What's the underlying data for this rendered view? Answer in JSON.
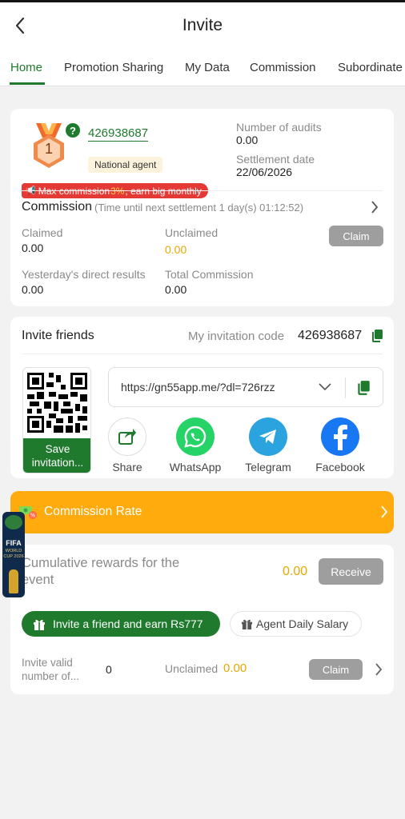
{
  "header": {
    "title": "Invite"
  },
  "tabs": [
    "Home",
    "Promotion Sharing",
    "My Data",
    "Commission",
    "Subordinate"
  ],
  "agent": {
    "level": "1",
    "id": "426938687",
    "badge": "National agent",
    "audits_label": "Number of audits",
    "audits_value": "0.00",
    "settlement_label": "Settlement date",
    "settlement_value": "22/06/2026"
  },
  "promo_banner": {
    "text_before": "Max commission ",
    "highlight": "3%",
    "text_after": ", earn big monthly"
  },
  "commission": {
    "title": "Commission",
    "countdown": "(Time until next settlement  1 day(s) 01:12:52)",
    "claimed_label": "Claimed",
    "claimed_value": "0.00",
    "unclaimed_label": "Unclaimed",
    "unclaimed_value": "0.00",
    "claim_button": "Claim",
    "yesterday_label": "Yesterday's direct results",
    "yesterday_value": "0.00",
    "total_label": "Total Commission",
    "total_value": "0.00"
  },
  "invite": {
    "title": "Invite friends",
    "code_label": "My invitation code",
    "code_value": "426938687",
    "link": "https://gn55app.me/?dl=726rzz",
    "save_label": "Save invitation...",
    "share": [
      {
        "label": "Share",
        "icon": "share-icon",
        "color": "#1f7a2e"
      },
      {
        "label": "WhatsApp",
        "icon": "whatsapp-icon",
        "color": "#25d366"
      },
      {
        "label": "Telegram",
        "icon": "telegram-icon",
        "color": "#2aa3df"
      },
      {
        "label": "Facebook",
        "icon": "facebook-icon",
        "color": "#1877f2"
      }
    ]
  },
  "commission_rate": {
    "label": "Commission Rate"
  },
  "floating_badge": {
    "text_top": "FIFA",
    "text_bottom": "WORLD CUP 2026"
  },
  "rewards": {
    "title": "Cumulative rewards for the event",
    "value": "0.00",
    "receive_button": "Receive",
    "invite_button": "Invite a friend and earn Rs777",
    "salary_button": "Agent Daily Salary",
    "valid_label": "Invite valid number of...",
    "valid_value": "0",
    "unclaimed_label": "Unclaimed",
    "unclaimed_value": "0.00",
    "claim_button": "Claim"
  },
  "colors": {
    "brand_green": "#1f7a2e",
    "accent_orange": "#ffaa0d",
    "gold_value": "#e5a800",
    "banner_red": "#e53935"
  }
}
